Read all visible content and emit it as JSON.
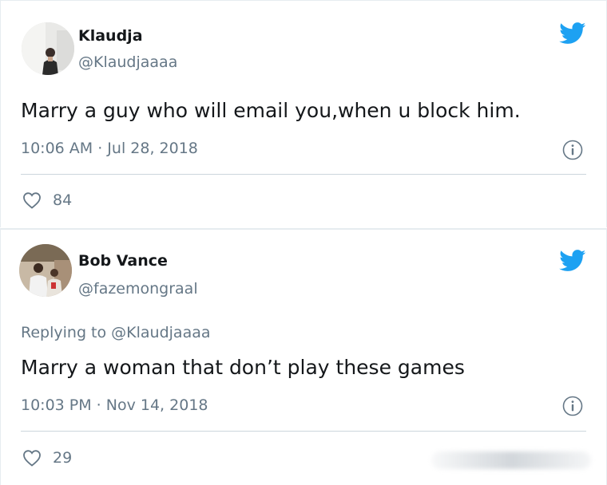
{
  "tweets": [
    {
      "name": "Klaudja",
      "handle": "@Klaudjaaaa",
      "text": "Marry a guy who will email you,when u block him.",
      "timestamp": "10:06 AM · Jul 28, 2018",
      "likes": "84",
      "icons": [
        "avatar",
        "twitter-bird-icon",
        "info-icon",
        "heart-icon"
      ]
    },
    {
      "name": "Bob Vance",
      "handle": "@fazemongraal",
      "replying_prefix": "Replying to",
      "replying_to": "@Klaudjaaaa",
      "text": "Marry a woman that don’t play these games",
      "timestamp": "10:03 PM · Nov 14, 2018",
      "likes": "29",
      "icons": [
        "avatar",
        "twitter-bird-icon",
        "info-icon",
        "heart-icon"
      ]
    }
  ],
  "colors": {
    "twitter_blue": "#1da1f2",
    "text_primary": "#14171a",
    "text_secondary": "#657786",
    "divider": "#ccd6dd"
  }
}
